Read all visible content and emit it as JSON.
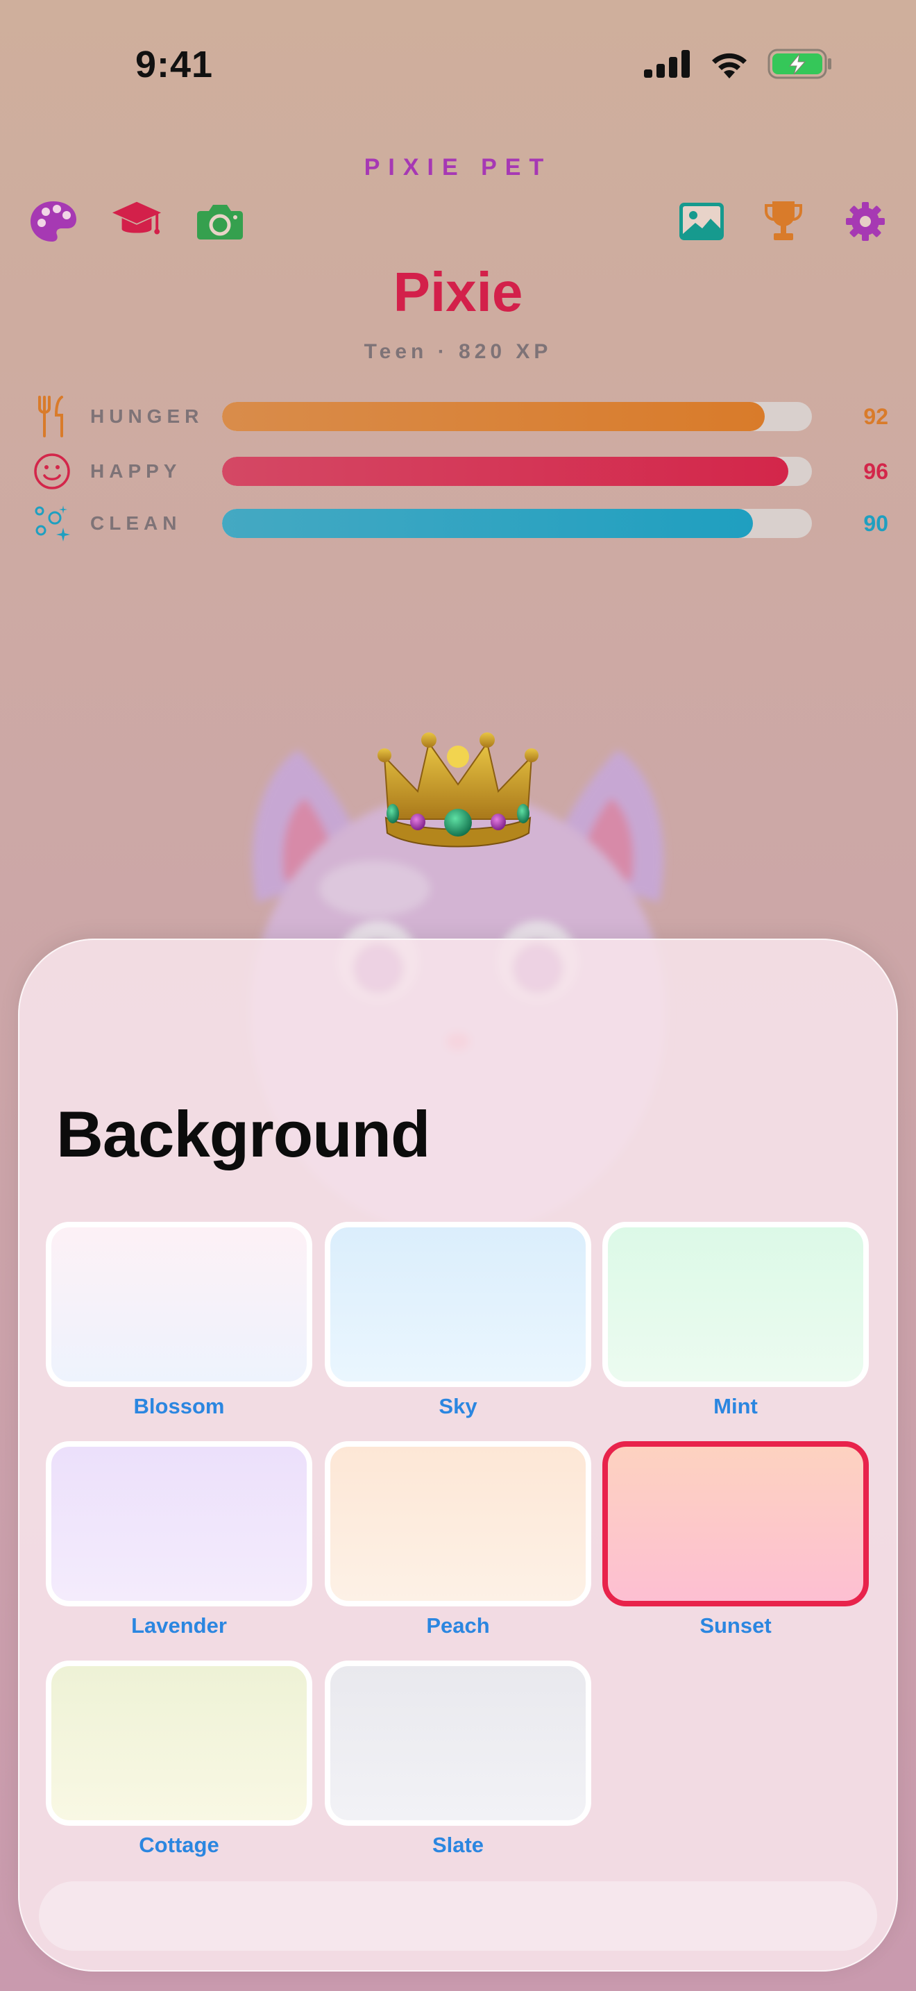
{
  "status_bar": {
    "time": "9:41"
  },
  "app": {
    "title": "PIXIE PET",
    "top_icons_left": [
      "palette-icon",
      "graduation-cap-icon",
      "camera-icon"
    ],
    "top_icons_right": [
      "photo-icon",
      "trophy-icon",
      "gear-icon"
    ]
  },
  "pet": {
    "name": "Pixie",
    "subtitle": "Teen · 820 XP",
    "accessory": "crown"
  },
  "stats": [
    {
      "label": "HUNGER",
      "value": "92",
      "fraction": 0.92,
      "color": "#d97b2a",
      "icon": "fork-knife-icon"
    },
    {
      "label": "HAPPY",
      "value": "96",
      "fraction": 0.96,
      "color": "#d3264a",
      "icon": "smiley-icon"
    },
    {
      "label": "CLEAN",
      "value": "90",
      "fraction": 0.9,
      "color": "#1f9fc0",
      "icon": "sparkles-icon"
    }
  ],
  "sheet": {
    "title": "Background",
    "options": [
      {
        "label": "Blossom",
        "selected": false,
        "colors": [
          "#fdf1f6",
          "#eef3fd"
        ]
      },
      {
        "label": "Sky",
        "selected": false,
        "colors": [
          "#dbeefc",
          "#eaf6fe"
        ]
      },
      {
        "label": "Mint",
        "selected": false,
        "colors": [
          "#dcf9e7",
          "#ecfbf0"
        ]
      },
      {
        "label": "Lavender",
        "selected": false,
        "colors": [
          "#ece0fb",
          "#f4ecfc"
        ]
      },
      {
        "label": "Peach",
        "selected": false,
        "colors": [
          "#fde7d6",
          "#fdf1e6"
        ]
      },
      {
        "label": "Sunset",
        "selected": true,
        "colors": [
          "#fdd2c0",
          "#fdbfd2"
        ]
      },
      {
        "label": "Cottage",
        "selected": false,
        "colors": [
          "#eef2d6",
          "#f9f8e4"
        ]
      },
      {
        "label": "Slate",
        "selected": false,
        "colors": [
          "#e9e9ee",
          "#f2f2f6"
        ]
      }
    ]
  },
  "colors": {
    "accent": "#a638b4",
    "name": "#d3204a",
    "label": "#2b86e0",
    "selected": "#e8234b"
  }
}
